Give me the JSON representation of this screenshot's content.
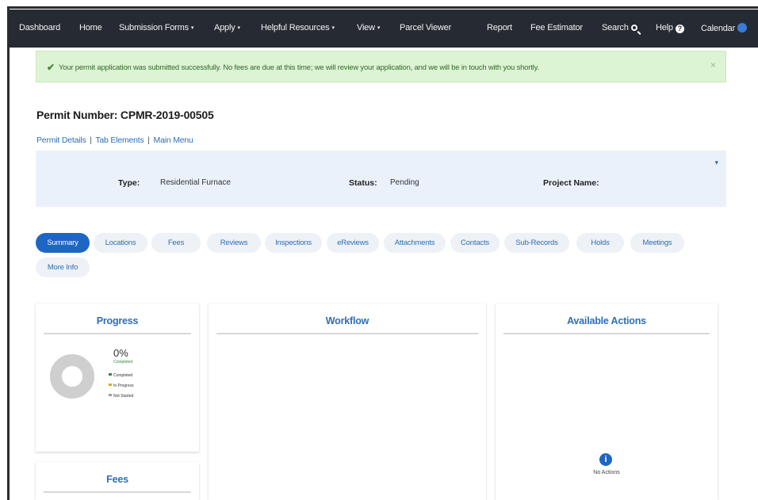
{
  "nav": {
    "items": [
      {
        "label": "Dashboard"
      },
      {
        "label": "Home"
      },
      {
        "label": "Submission Forms",
        "caret": "▾"
      },
      {
        "label": "Apply",
        "caret": "▾"
      },
      {
        "label": "Helpful Resources",
        "caret": "▾"
      },
      {
        "label": "View",
        "caret": "▾"
      },
      {
        "label": "Parcel Viewer"
      },
      {
        "label": "Report"
      },
      {
        "label": "Fee Estimator"
      },
      {
        "label": "Search",
        "icon": "search-icon"
      },
      {
        "label": "Help",
        "icon": "help-icon",
        "glyph": "?"
      },
      {
        "label": "Calendar",
        "icon": "calendar-badge-icon"
      }
    ]
  },
  "alert": {
    "check": "✔",
    "message": "Your permit application was submitted successfully. No fees are due at this time; we will review your application, and we will be in touch with you shortly.",
    "close": "×"
  },
  "permit": {
    "title": "Permit Number: CPMR-2019-00505",
    "links": [
      "Permit Details",
      "Tab Elements",
      "Main Menu"
    ],
    "link_sep": "|"
  },
  "info": {
    "chevron": "▾",
    "type_label": "Type:",
    "type_value": "Residential Furnace",
    "status_label": "Status:",
    "status_value": "Pending",
    "project_label": "Project Name:",
    "project_value": ""
  },
  "tabs": [
    "Summary",
    "Locations",
    "Fees",
    "Reviews",
    "Inspections",
    "eReviews",
    "Attachments",
    "Contacts",
    "Sub-Records",
    "Holds",
    "Meetings",
    "More Info"
  ],
  "active_tab": "Summary",
  "cards": {
    "progress": {
      "title": "Progress",
      "percent": "0%",
      "percent_sub": "Completed",
      "legend": [
        "Completed",
        "In Progress",
        "Not Started"
      ],
      "legend_colors": [
        "#2f8a3a",
        "#e0a52a",
        "#9e9e9e"
      ]
    },
    "workflow": {
      "title": "Workflow"
    },
    "actions": {
      "title": "Available Actions",
      "icon_glyph": "i",
      "empty_text": "No Actions"
    },
    "fees": {
      "title": "Fees"
    }
  },
  "colors": {
    "nav_bg": "#262b33",
    "accent": "#1d66c4",
    "link": "#2d6fb6",
    "alert_bg": "#dcf3d4",
    "panel_bg": "#eaf1fb"
  }
}
